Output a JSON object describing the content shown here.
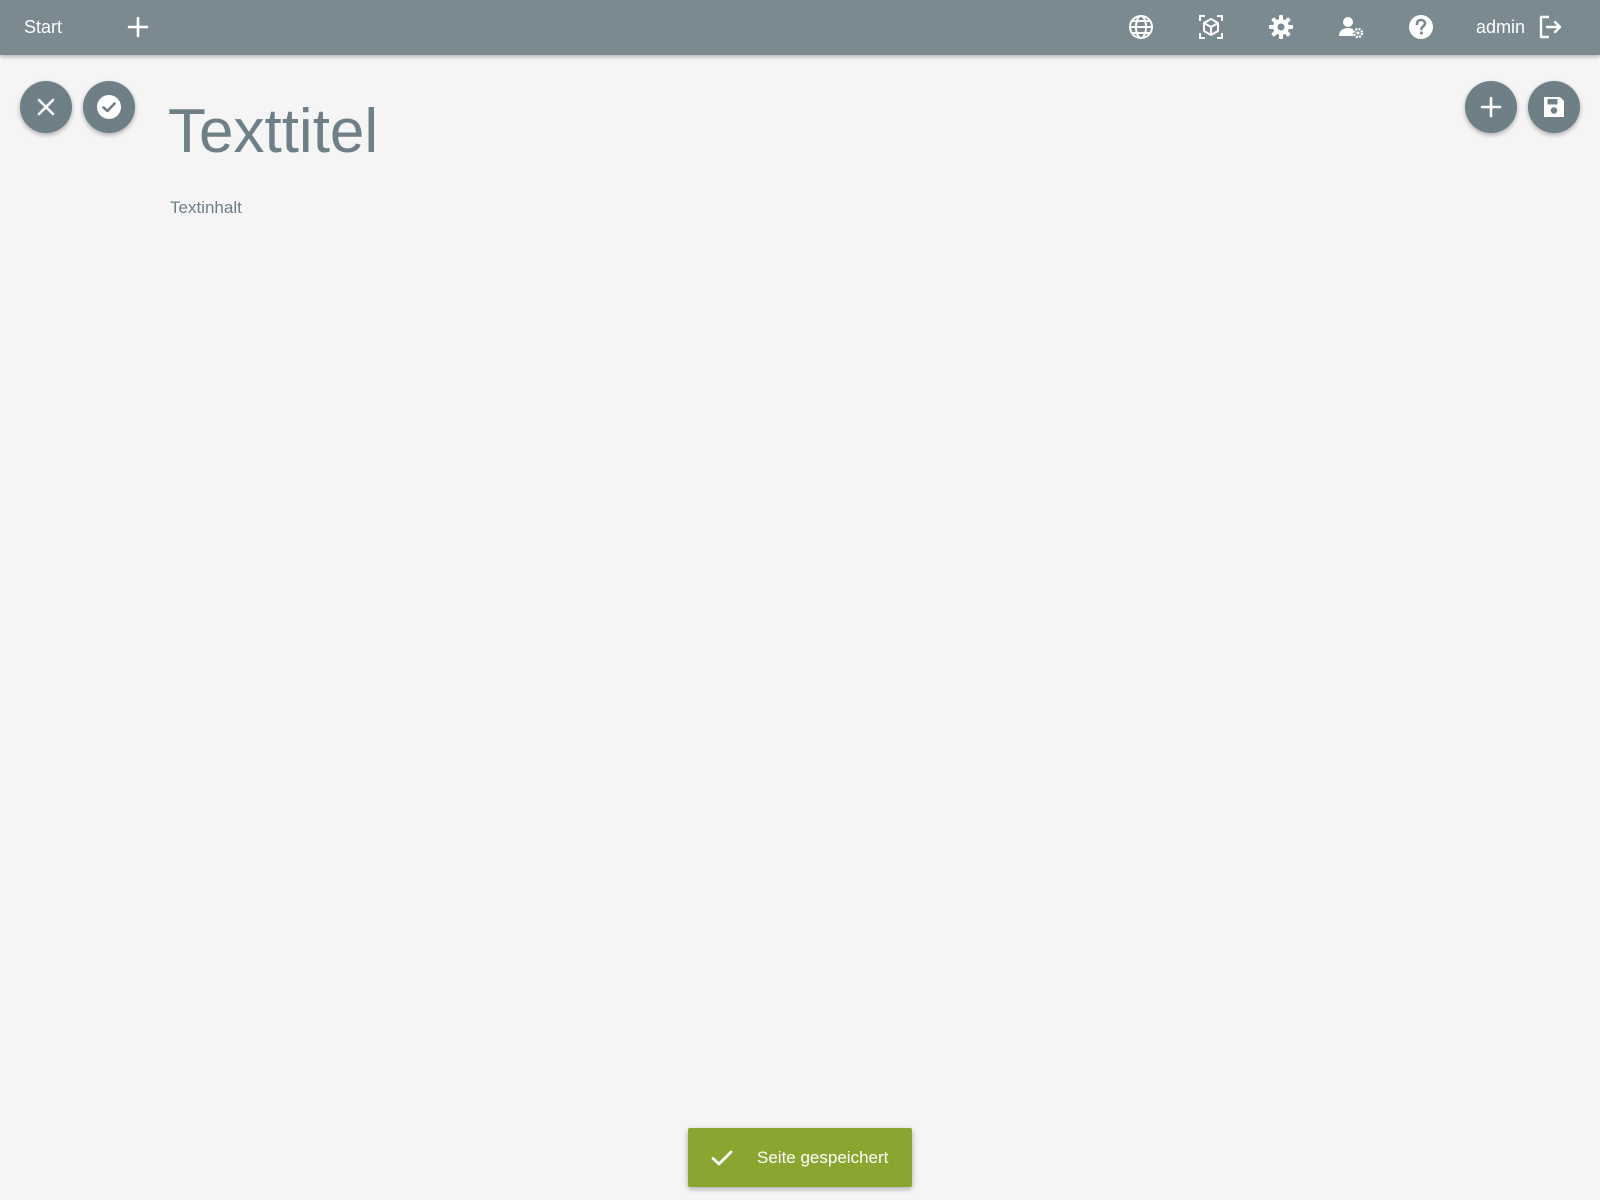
{
  "header": {
    "start_label": "Start",
    "username": "admin",
    "icons": [
      "add-icon",
      "globe-icon",
      "cube-scan-icon",
      "gear-icon",
      "user-settings-icon",
      "help-icon",
      "logout-icon"
    ]
  },
  "toolbar_left": {
    "buttons": [
      "close-icon",
      "check-circle-icon"
    ]
  },
  "toolbar_right": {
    "buttons": [
      "add-icon",
      "save-icon"
    ]
  },
  "page": {
    "title": "Texttitel",
    "content": "Textinhalt"
  },
  "toast": {
    "message": "Seite gespeichert",
    "icon": "check-icon",
    "color": "#8aa631"
  },
  "colors": {
    "topbar": "#7b8a91",
    "fab": "#6f7f87",
    "background": "#f5f5f5",
    "text": "#6f7f87"
  }
}
